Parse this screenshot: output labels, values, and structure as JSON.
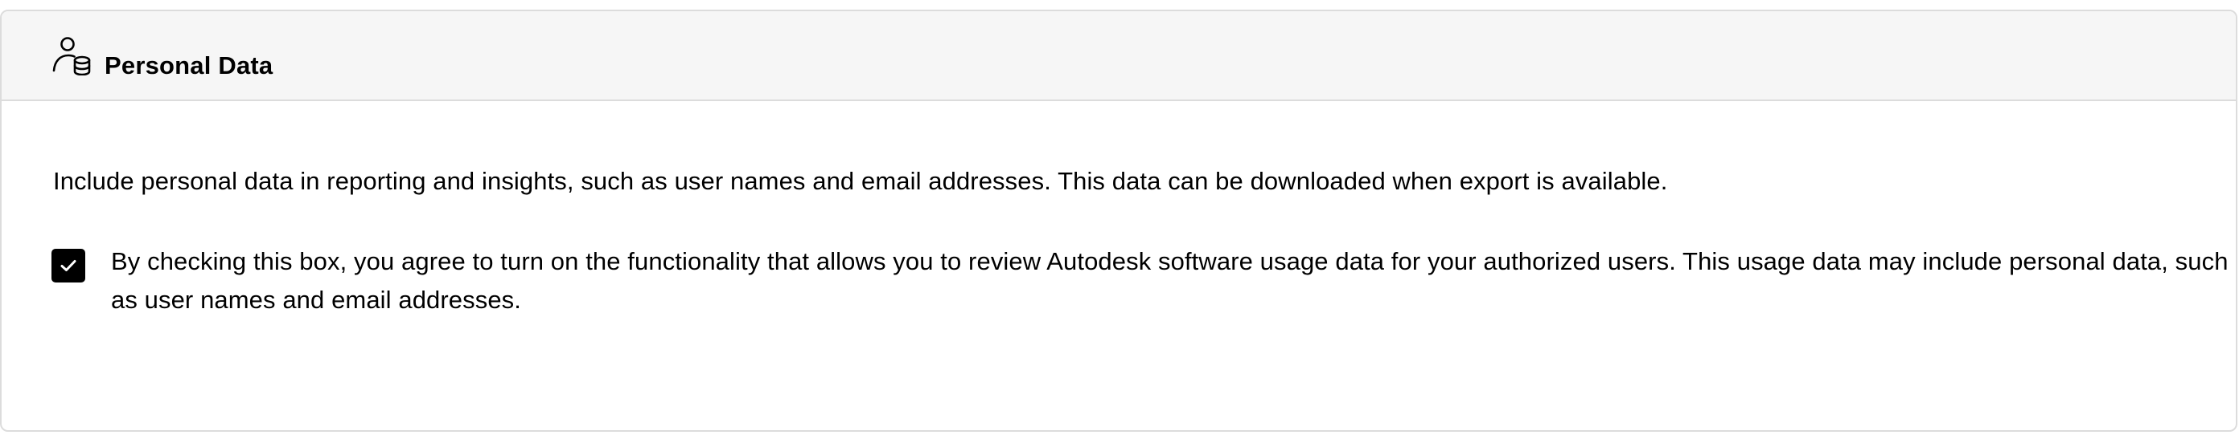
{
  "section": {
    "title": "Personal Data",
    "icon": "user-database-icon"
  },
  "description": "Include personal data in reporting and insights, such as user names and email addresses. This data can be downloaded when export is available.",
  "consent": {
    "checked": true,
    "label": "By checking this box, you agree to turn on the functionality that allows you to review Autodesk software usage data for your authorized users. This usage data may include personal data, such as user names and email addresses."
  },
  "colors": {
    "header_background": "#f6f6f6",
    "border": "#dcdcdc",
    "checkbox_fill": "#000000",
    "text": "#000000"
  }
}
